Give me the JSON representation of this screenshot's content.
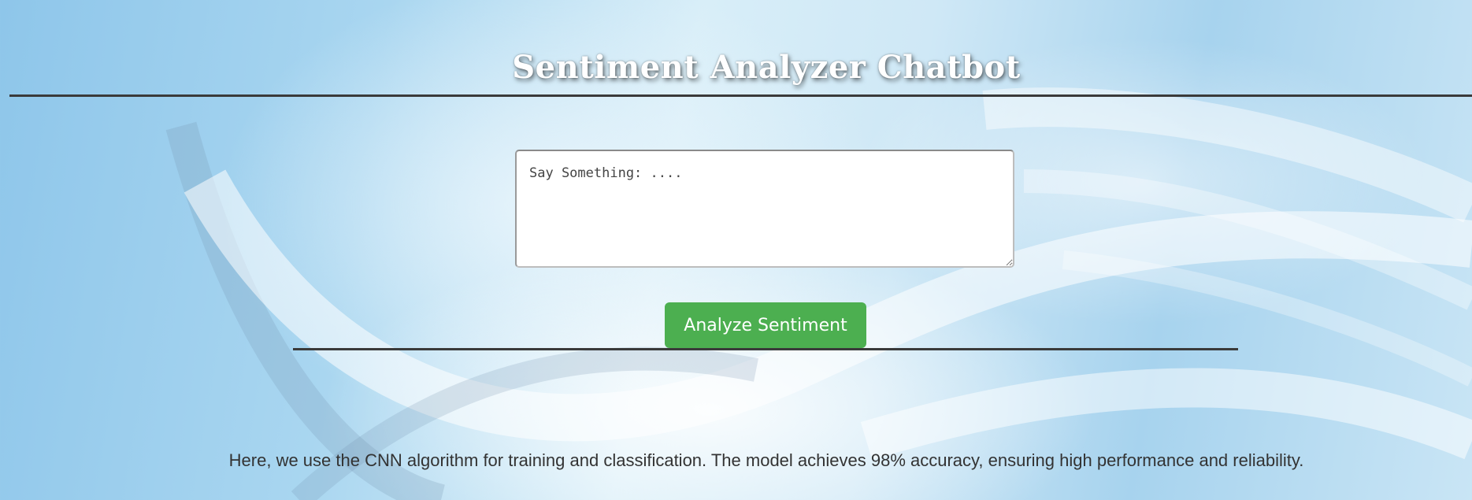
{
  "header": {
    "title": "Sentiment Analyzer Chatbot"
  },
  "chat": {
    "input_placeholder": "Say Something: ....",
    "input_value": "",
    "submit_label": "Analyze Sentiment"
  },
  "footer": {
    "description": "Here, we use the CNN algorithm for training and classification. The model achieves 98% accuracy, ensuring high performance and reliability."
  },
  "theme": {
    "accent": "#4caf50",
    "rule_color": "#3a3a3a",
    "title_color": "#ffffff"
  }
}
